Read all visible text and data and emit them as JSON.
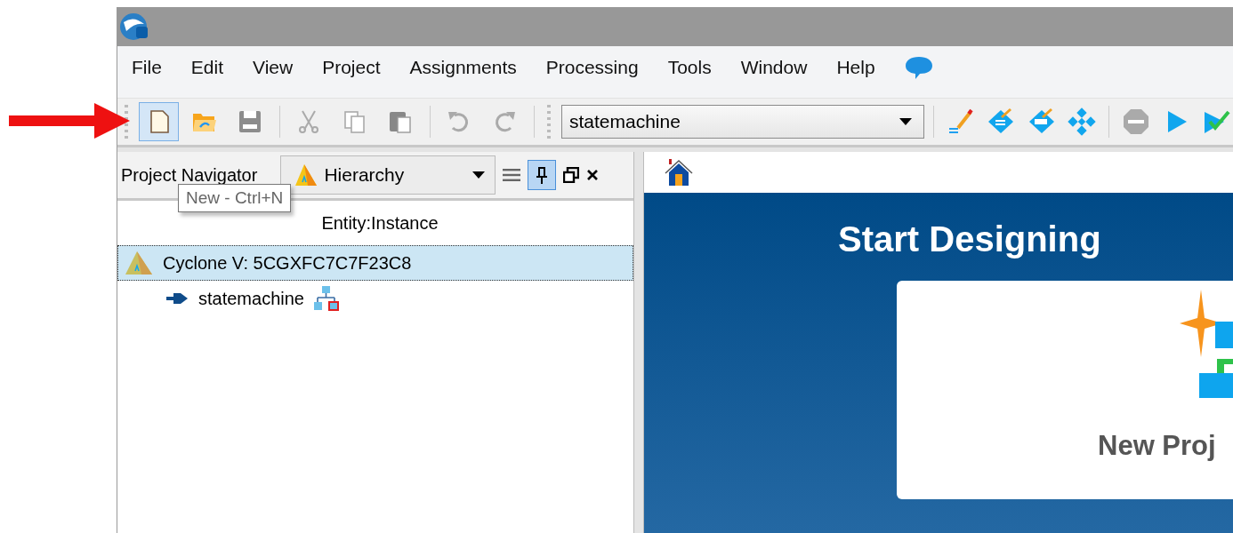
{
  "menu": [
    "File",
    "Edit",
    "View",
    "Project",
    "Assignments",
    "Processing",
    "Tools",
    "Window",
    "Help"
  ],
  "toolbar_left": [
    {
      "kind": "new",
      "highlighted": true
    },
    {
      "kind": "open",
      "highlighted": false
    },
    {
      "kind": "save",
      "highlighted": false
    },
    {
      "kind": "sep"
    },
    {
      "kind": "cut",
      "highlighted": false
    },
    {
      "kind": "copy",
      "highlighted": false
    },
    {
      "kind": "paste",
      "highlighted": false
    },
    {
      "kind": "sep"
    },
    {
      "kind": "undo",
      "highlighted": false
    },
    {
      "kind": "redo",
      "highlighted": false
    }
  ],
  "entity_combo": {
    "value": "statemachine"
  },
  "toolbar_right": [
    {
      "kind": "edit",
      "highlighted": false
    },
    {
      "kind": "analysis",
      "highlighted": false
    },
    {
      "kind": "synthesis",
      "highlighted": false
    },
    {
      "kind": "fitter",
      "highlighted": false
    },
    {
      "kind": "sep"
    },
    {
      "kind": "stop",
      "highlighted": false
    },
    {
      "kind": "start",
      "highlighted": false
    },
    {
      "kind": "check",
      "highlighted": false
    }
  ],
  "tooltip": "New - Ctrl+N",
  "navigator": {
    "title": "Project Navigator",
    "view": "Hierarchy",
    "pinned": true,
    "column": "Entity:Instance",
    "tree": [
      {
        "label": "Cyclone V: 5CGXFC7C7F23C8",
        "kind": "device",
        "selected": true,
        "children": [
          {
            "label": "statemachine",
            "kind": "entity",
            "selected": false
          }
        ]
      }
    ]
  },
  "home": {
    "title": "Start Designing",
    "card_title": "New Proj"
  }
}
